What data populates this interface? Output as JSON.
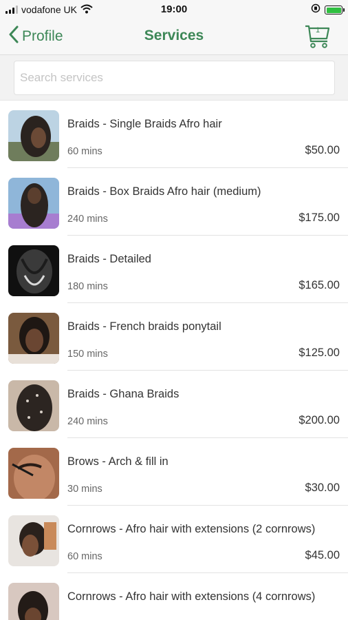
{
  "status_bar": {
    "carrier": "vodafone UK",
    "time": "19:00",
    "battery_level": 1.0
  },
  "nav": {
    "back_label": "Profile",
    "title": "Services",
    "cart_count": "1"
  },
  "search": {
    "placeholder": "Search services",
    "value": ""
  },
  "services": [
    {
      "name": "Braids -  Single Braids Afro hair",
      "duration": "60 mins",
      "price": "$50.00"
    },
    {
      "name": "Braids - Box Braids Afro hair (medium)",
      "duration": "240 mins",
      "price": "$175.00"
    },
    {
      "name": "Braids - Detailed",
      "duration": "180 mins",
      "price": "$165.00"
    },
    {
      "name": "Braids - French braids ponytail",
      "duration": "150 mins",
      "price": "$125.00"
    },
    {
      "name": "Braids - Ghana Braids",
      "duration": "240 mins",
      "price": "$200.00"
    },
    {
      "name": "Brows - Arch & fill in",
      "duration": "30 mins",
      "price": "$30.00"
    },
    {
      "name": "Cornrows - Afro hair with extensions (2 cornrows)",
      "duration": "60 mins",
      "price": "$45.00"
    },
    {
      "name": "Cornrows - Afro hair with extensions (4 cornrows)",
      "duration": "",
      "price": ""
    }
  ],
  "colors": {
    "accent": "#3d8757",
    "nav_background": "#f7f7f7",
    "battery": "#2fbf40"
  }
}
